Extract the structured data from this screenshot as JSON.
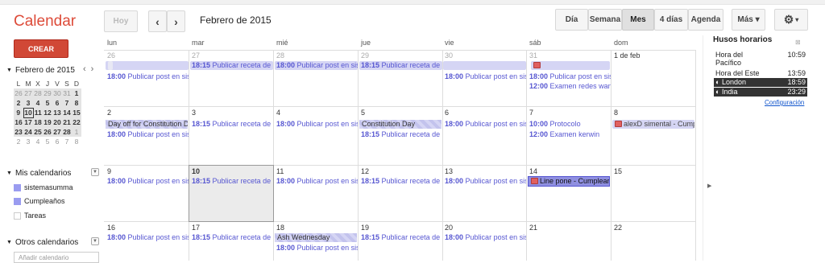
{
  "app": {
    "title": "Calendar",
    "create_label": "CREAR"
  },
  "toolbar": {
    "today": "Hoy",
    "prev": "‹",
    "next": "›",
    "period": "Febrero de 2015",
    "views": [
      "Día",
      "Semana",
      "Mes",
      "4 días",
      "Agenda"
    ],
    "selected_view": "Mes",
    "more": "Más ▾",
    "settings_icon": "gear-icon"
  },
  "mini": {
    "title": "Febrero de 2015",
    "prev": "‹",
    "next": "›",
    "headers": [
      "L",
      "M",
      "X",
      "J",
      "V",
      "S",
      "D"
    ],
    "rows": [
      [
        "26",
        "27",
        "28",
        "29",
        "30",
        "31",
        "1"
      ],
      [
        "2",
        "3",
        "4",
        "5",
        "6",
        "7",
        "8"
      ],
      [
        "9",
        "10",
        "11",
        "12",
        "13",
        "14",
        "15"
      ],
      [
        "16",
        "17",
        "18",
        "19",
        "20",
        "21",
        "22"
      ],
      [
        "23",
        "24",
        "25",
        "26",
        "27",
        "28",
        "1"
      ],
      [
        "2",
        "3",
        "4",
        "5",
        "6",
        "7",
        "8"
      ]
    ]
  },
  "my_calendars": {
    "title": "Mis calendarios",
    "items": [
      {
        "name": "sistemasumma",
        "color": "#9a9cf0"
      },
      {
        "name": "Cumpleaños",
        "color": "#9a9cf0"
      },
      {
        "name": "Tareas",
        "color": "#ffffff"
      }
    ]
  },
  "other_calendars": {
    "title": "Otros calendarios",
    "add_placeholder": "Añadir calendario"
  },
  "grid": {
    "day_headers": [
      "lun",
      "mar",
      "mié",
      "jue",
      "vie",
      "sáb",
      "dom"
    ],
    "weeks": [
      {
        "days": [
          "26",
          "27",
          "28",
          "29",
          "30",
          "31",
          "1 de feb"
        ]
      },
      {
        "days": [
          "2",
          "3",
          "4",
          "5",
          "6",
          "7",
          "8"
        ]
      },
      {
        "days": [
          "9",
          "10",
          "11",
          "12",
          "13",
          "14",
          "15"
        ]
      },
      {
        "days": [
          "16",
          "17",
          "18",
          "19",
          "20",
          "21",
          "22"
        ]
      }
    ],
    "events": {
      "w0": {
        "mon_allday": "P",
        "mon": {
          "time": "18:00",
          "text": "Publicar post en sis"
        },
        "tue": {
          "time": "18:15",
          "text": "Publicar receta de c"
        },
        "wed": {
          "time": "18:00",
          "text": "Publicar post en sis"
        },
        "thu": {
          "time": "18:15",
          "text": "Publicar receta de c"
        },
        "fri": {
          "time": "18:00",
          "text": "Publicar post en sis"
        },
        "sat1": {
          "time": "18:00",
          "text": "Publicar post en sis"
        },
        "sat2": {
          "time": "12:00",
          "text": "Examen redes wan"
        }
      },
      "w1": {
        "mon_allday": "Day off for Constitution D",
        "mon": {
          "time": "18:00",
          "text": "Publicar post en sis"
        },
        "tue": {
          "time": "18:15",
          "text": "Publicar receta de c"
        },
        "wed": {
          "time": "18:00",
          "text": "Publicar post en sis"
        },
        "thu_allday": "Constitution Day",
        "thu": {
          "time": "18:15",
          "text": "Publicar receta de c"
        },
        "fri": {
          "time": "18:00",
          "text": "Publicar post en sis"
        },
        "sat1": {
          "time": "10:00",
          "text": "Protocolo"
        },
        "sat2": {
          "time": "12:00",
          "text": "Examen kerwin"
        },
        "sun": "alexD simental - Cump"
      },
      "w2": {
        "mon": {
          "time": "18:00",
          "text": "Publicar post en sis"
        },
        "tue": {
          "time": "18:15",
          "text": "Publicar receta de c"
        },
        "wed": {
          "time": "18:00",
          "text": "Publicar post en sis"
        },
        "thu": {
          "time": "18:15",
          "text": "Publicar receta de c"
        },
        "fri": {
          "time": "18:00",
          "text": "Publicar post en sis"
        },
        "sat": "Line pone - Cumplear"
      },
      "w3": {
        "mon": {
          "time": "18:00",
          "text": "Publicar post en sis"
        },
        "tue": {
          "time": "18:15",
          "text": "Publicar receta de c"
        },
        "wed_allday": "Ash Wednesday",
        "wed": {
          "time": "18:00",
          "text": "Publicar post en sis"
        },
        "thu": {
          "time": "18:15",
          "text": "Publicar receta de c"
        },
        "fri": {
          "time": "18:00",
          "text": "Publicar post en sis"
        }
      }
    }
  },
  "timezones": {
    "title": "Husos horarios",
    "close": "⊠",
    "items": [
      {
        "name": "Hora del Pacífico",
        "time": "10:59"
      },
      {
        "name": "Hora del Este",
        "time": "13:59"
      },
      {
        "name": "London",
        "time": "18:59"
      },
      {
        "name": "India",
        "time": "23:29"
      }
    ],
    "config_link": "Configuración"
  }
}
